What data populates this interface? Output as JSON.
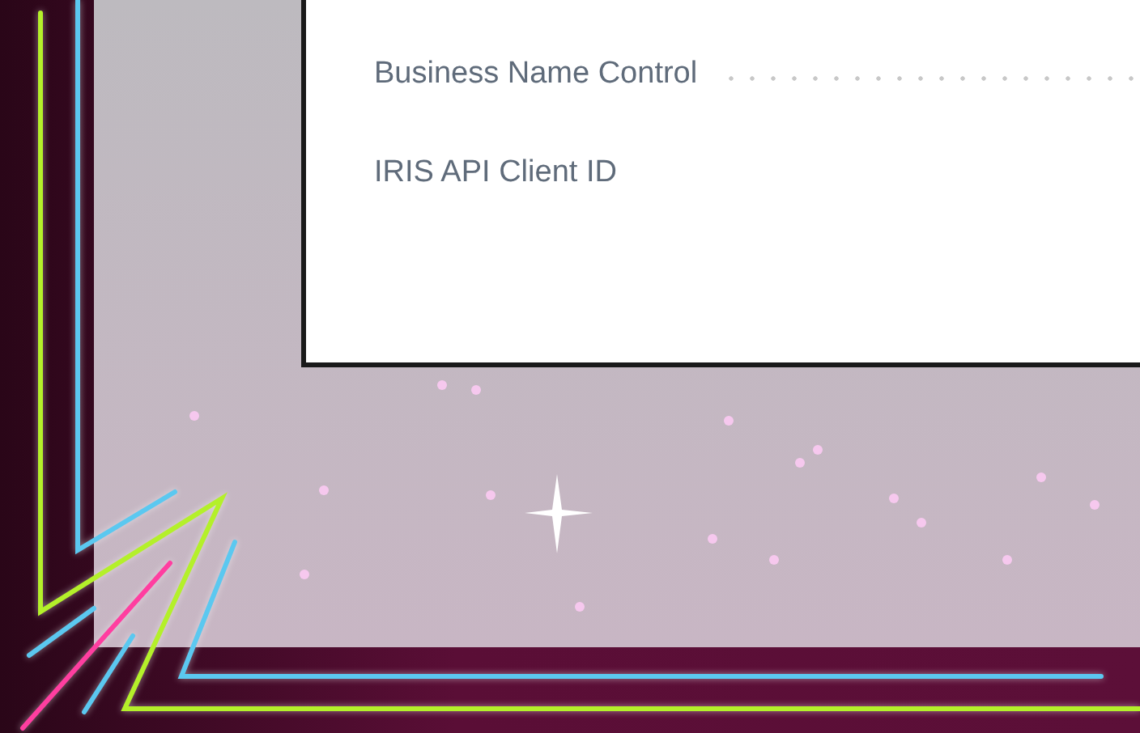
{
  "form": {
    "fields": [
      {
        "label": "Business Name Control",
        "dotted_leader": true
      },
      {
        "label": "IRIS API Client ID",
        "dotted_leader": false
      }
    ]
  }
}
